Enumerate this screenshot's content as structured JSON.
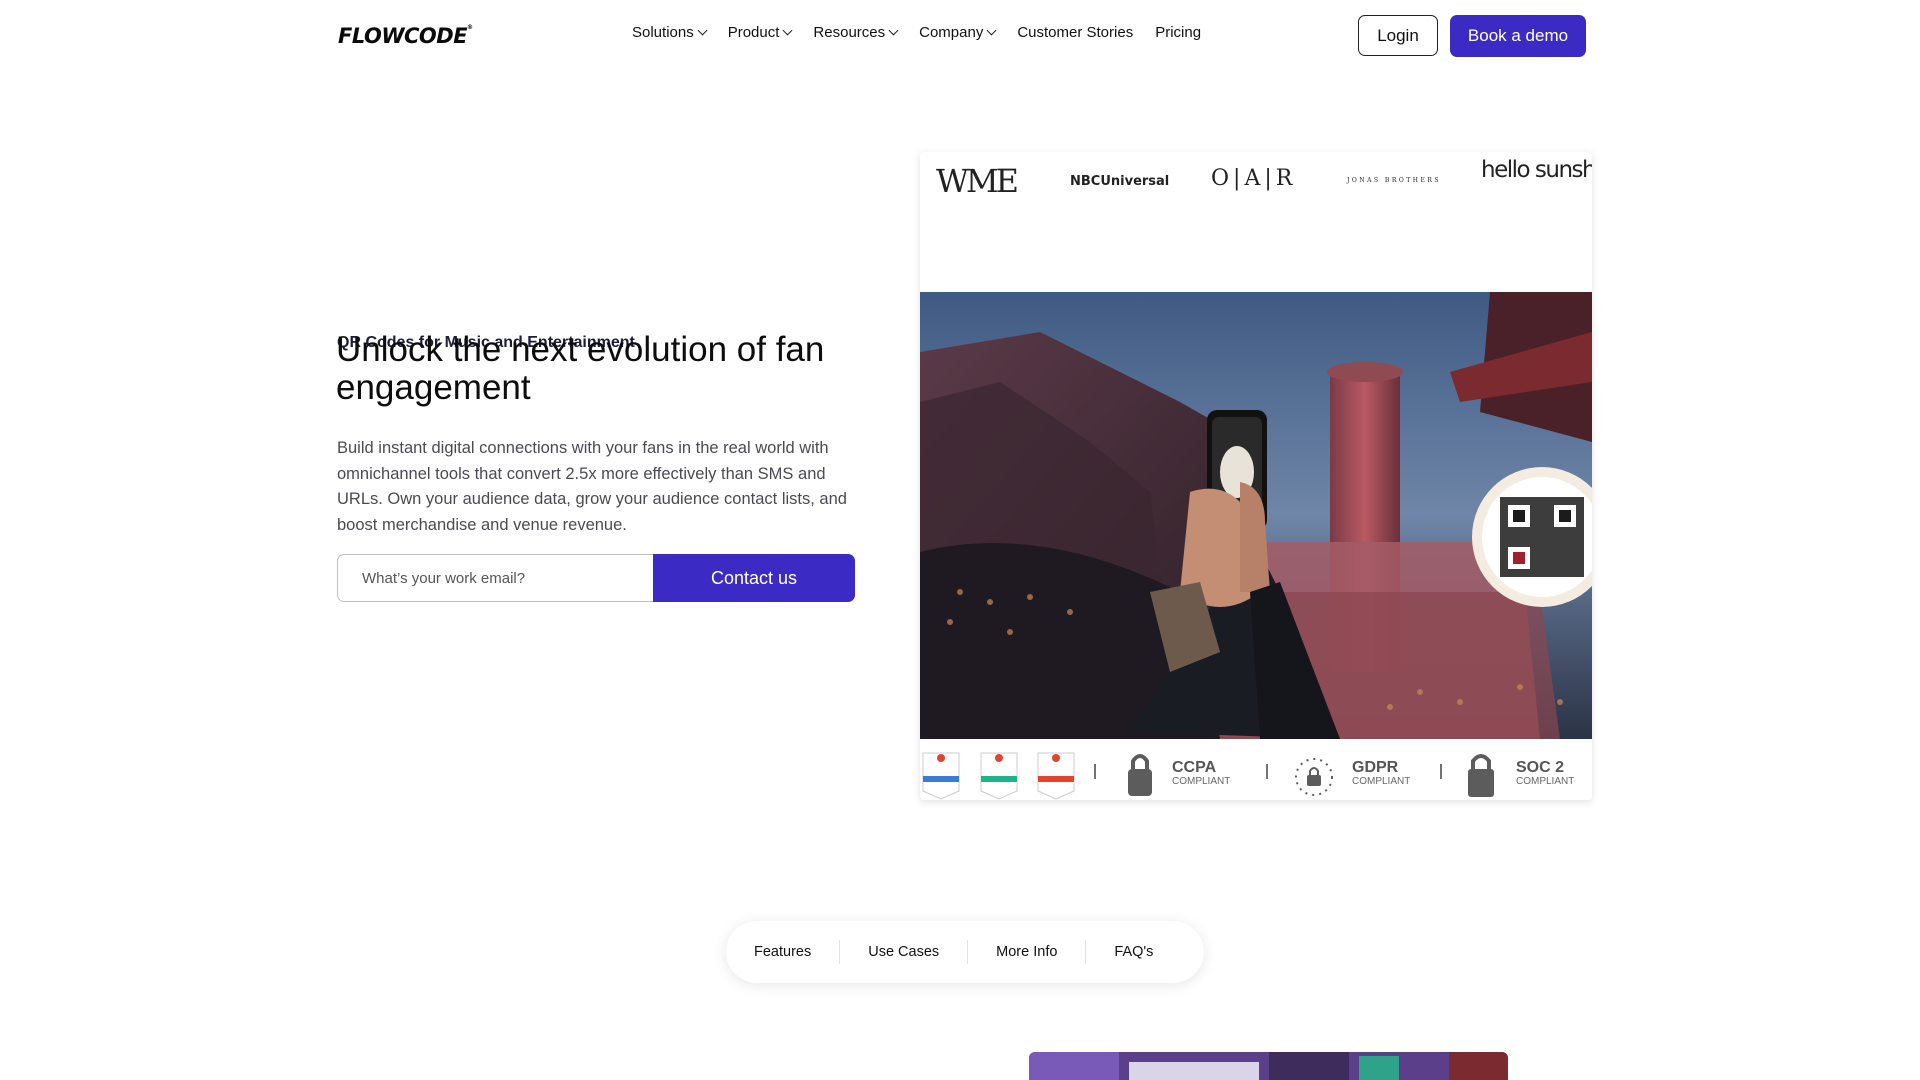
{
  "header": {
    "logo": "FLOWCODE",
    "nav": [
      {
        "label": "Solutions",
        "dropdown": true
      },
      {
        "label": "Product",
        "dropdown": true
      },
      {
        "label": "Resources",
        "dropdown": true
      },
      {
        "label": "Company",
        "dropdown": true
      },
      {
        "label": "Customer Stories",
        "dropdown": false
      },
      {
        "label": "Pricing",
        "dropdown": false
      }
    ],
    "login_label": "Login",
    "demo_label": "Book a demo"
  },
  "hero": {
    "eyebrow": "QR Codes for Music and Entertainment",
    "headline": "Unlock the next evolution of fan engagement",
    "description": "Build instant digital connections with your fans in the real world with omnichannel tools that convert 2.5x more effectively than SMS and URLs. Own your audience data, grow your audience contact lists, and boost merchandise and venue revenue.",
    "email_placeholder": "What’s your work email?",
    "contact_label": "Contact us"
  },
  "card": {
    "brands": [
      "WME",
      "NBCUniversal",
      "O|A|R",
      "JONAS BROTHERS",
      "hello sunshine"
    ],
    "compliance": [
      {
        "name": "CCPA",
        "sub": "COMPLIANT"
      },
      {
        "name": "GDPR",
        "sub": "COMPLIANT"
      },
      {
        "name": "SOC 2",
        "sub": "COMPLIANT"
      }
    ]
  },
  "tabs": [
    "Features",
    "Use Cases",
    "More Info",
    "FAQ's"
  ],
  "colors": {
    "accent": "#3b2bc4",
    "text": "#111111",
    "muted": "#4a4a55"
  }
}
